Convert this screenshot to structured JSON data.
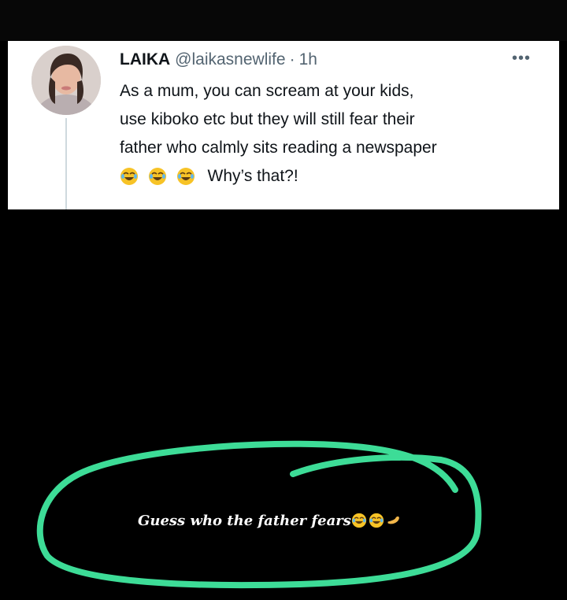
{
  "tweet": {
    "author_name": "LAIKA",
    "handle": "@laikasnewlife",
    "separator": "·",
    "time": "1h",
    "more_icon": "more-horizontal-icon",
    "body_lines": [
      "As a mum, you can scream at your kids,",
      "use kiboko etc but they will still fear their",
      "father who calmly sits reading a newspaper"
    ],
    "emoji_icon": "face-with-tears-of-joy-icon",
    "tail_text": "Why’s that?!"
  },
  "caption": {
    "text": "Guess who the father fears",
    "emojis": [
      "face-with-tears-of-joy-icon",
      "face-with-tears-of-joy-icon",
      "flexed-biceps-icon"
    ]
  },
  "colors": {
    "card_bg": "#ffffff",
    "page_bg": "#000000",
    "scribble": "#3ddc97",
    "name_text": "#0f1419",
    "meta_text": "#536471"
  }
}
